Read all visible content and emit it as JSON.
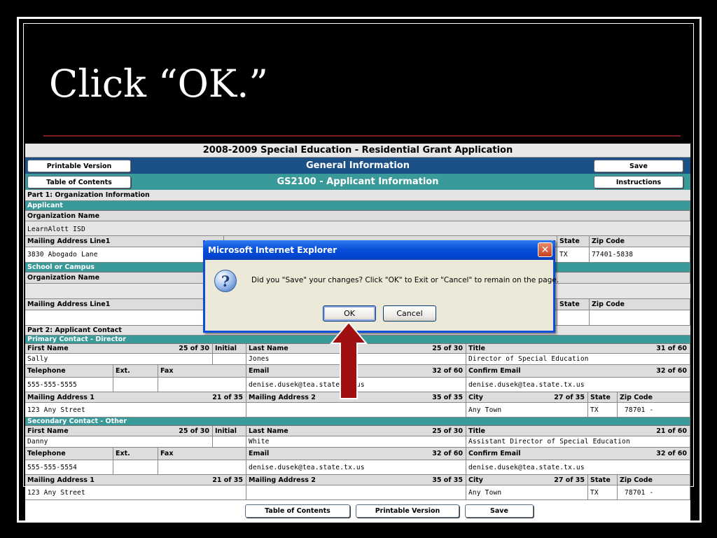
{
  "slide": {
    "title": "Click “OK.”"
  },
  "app": {
    "title": "2008-2009 Special Education - Residential Grant Application",
    "nav_section": "General Information",
    "nav_page": "GS2100 - Applicant Information",
    "buttons": {
      "printable": "Printable Version",
      "toc": "Table of Contents",
      "save": "Save",
      "instructions": "Instructions"
    }
  },
  "part1": {
    "heading": "Part 1: Organization Information",
    "applicant": {
      "section": "Applicant",
      "org_name_label": "Organization Name",
      "org_name": "LearnAlott ISD",
      "mail1_label": "Mailing Address Line1",
      "mail1": "3830 Abogado Lane",
      "state_label": "State",
      "state": "TX",
      "zip_label": "Zip Code",
      "zip": "77401-5838"
    },
    "school": {
      "section": "School or Campus",
      "org_name_label": "Organization Name",
      "mail1_label": "Mailing Address Line1",
      "state_label": "State",
      "zip_label": "Zip Code"
    }
  },
  "part2": {
    "heading": "Part 2: Applicant Contact",
    "primary": {
      "section": "Primary Contact - Director",
      "first_label": "First Name",
      "first_count": "25 of 30",
      "initial_label": "Initial",
      "last_label": "Last Name",
      "last_count": "25 of 30",
      "title_label": "Title",
      "title_count": "31 of 60",
      "first": "Sally",
      "last": "Jones",
      "title": "Director of Special Education",
      "tel_label": "Telephone",
      "ext_label": "Ext.",
      "fax_label": "Fax",
      "email_label": "Email",
      "email_count": "32 of 60",
      "confirm_label": "Confirm Email",
      "confirm_count": "32 of 60",
      "tel": "555-555-5555",
      "email": "denise.dusek@tea.state.tx.us",
      "confirm": "denise.dusek@tea.state.tx.us",
      "mail1_label": "Mailing Address 1",
      "mail1_count": "21 of 35",
      "mail2_label": "Mailing Address 2",
      "mail2_count": "35 of 35",
      "city_label": "City",
      "city_count": "27 of 35",
      "state_label": "State",
      "zip_label": "Zip Code",
      "mail1": "123 Any Street",
      "city": "Any Town",
      "state": "TX",
      "zip": "78701 -"
    },
    "secondary": {
      "section": "Secondary Contact - Other",
      "first_label": "First Name",
      "first_count": "25 of 30",
      "initial_label": "Initial",
      "last_label": "Last Name",
      "last_count": "25 of 30",
      "title_label": "Title",
      "title_count": "21 of 60",
      "first": "Danny",
      "last": "White",
      "title": "Assistant Director of Special Education",
      "tel_label": "Telephone",
      "ext_label": "Ext.",
      "fax_label": "Fax",
      "email_label": "Email",
      "email_count": "32 of 60",
      "confirm_label": "Confirm Email",
      "confirm_count": "32 of 60",
      "tel": "555-555-5554",
      "email": "denise.dusek@tea.state.tx.us",
      "confirm": "denise.dusek@tea.state.tx.us",
      "mail1_label": "Mailing Address 1",
      "mail1_count": "21 of 35",
      "mail2_label": "Mailing Address 2",
      "mail2_count": "35 of 35",
      "city_label": "City",
      "city_count": "27 of 35",
      "state_label": "State",
      "zip_label": "Zip Code",
      "mail1": "123 Any Street",
      "city": "Any Town",
      "state": "TX",
      "zip": "78701 -"
    }
  },
  "footer": {
    "toc": "Table of Contents",
    "printable": "Printable Version",
    "save": "Save"
  },
  "dialog": {
    "title": "Microsoft Internet Explorer",
    "close": "✕",
    "icon": "?",
    "message": "Did you \"Save\" your changes? Click \"OK\" to Exit or \"Cancel\" to remain on the page.",
    "ok": "OK",
    "cancel": "Cancel"
  },
  "icons": {
    "dialog_icon": "question-icon",
    "close_icon": "close-icon",
    "pointer": "arrow-up-icon"
  },
  "colors": {
    "nav_blue": "#1b5186",
    "teal": "#3a9a99",
    "arrow_red": "#a01010",
    "dialog_blue": "#0a4fd6"
  }
}
